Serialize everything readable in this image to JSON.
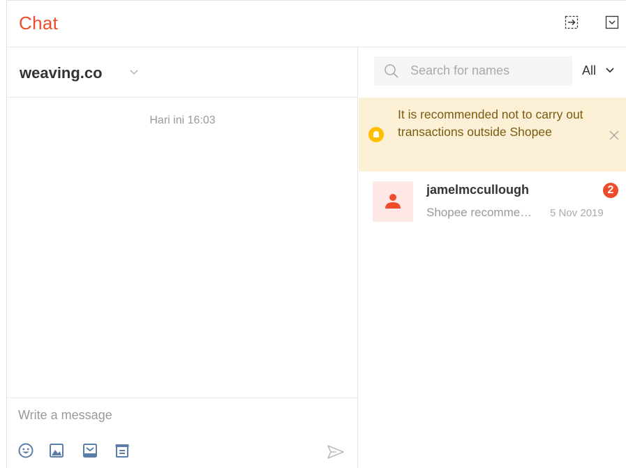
{
  "header": {
    "title": "Chat",
    "icons": [
      "exit-to-side-icon",
      "minimize-icon"
    ],
    "accent_color": "#ee4d2d"
  },
  "conversation": {
    "name": "weaving.co",
    "timestamp": "Hari ini 16:03",
    "composer": {
      "placeholder": "Write a message",
      "tools": [
        "emoji-icon",
        "image-icon",
        "product-icon",
        "order-icon"
      ],
      "send_icon": "send-icon"
    }
  },
  "sidebar": {
    "search_placeholder": "Search for names",
    "filter_label": "All",
    "notice": "It is recommended not to carry out transactions outside Shopee",
    "contacts": [
      {
        "name": "jamelmccullough",
        "preview": "Shopee recommends",
        "date": "5 Nov 2019",
        "unread": "2"
      }
    ]
  }
}
